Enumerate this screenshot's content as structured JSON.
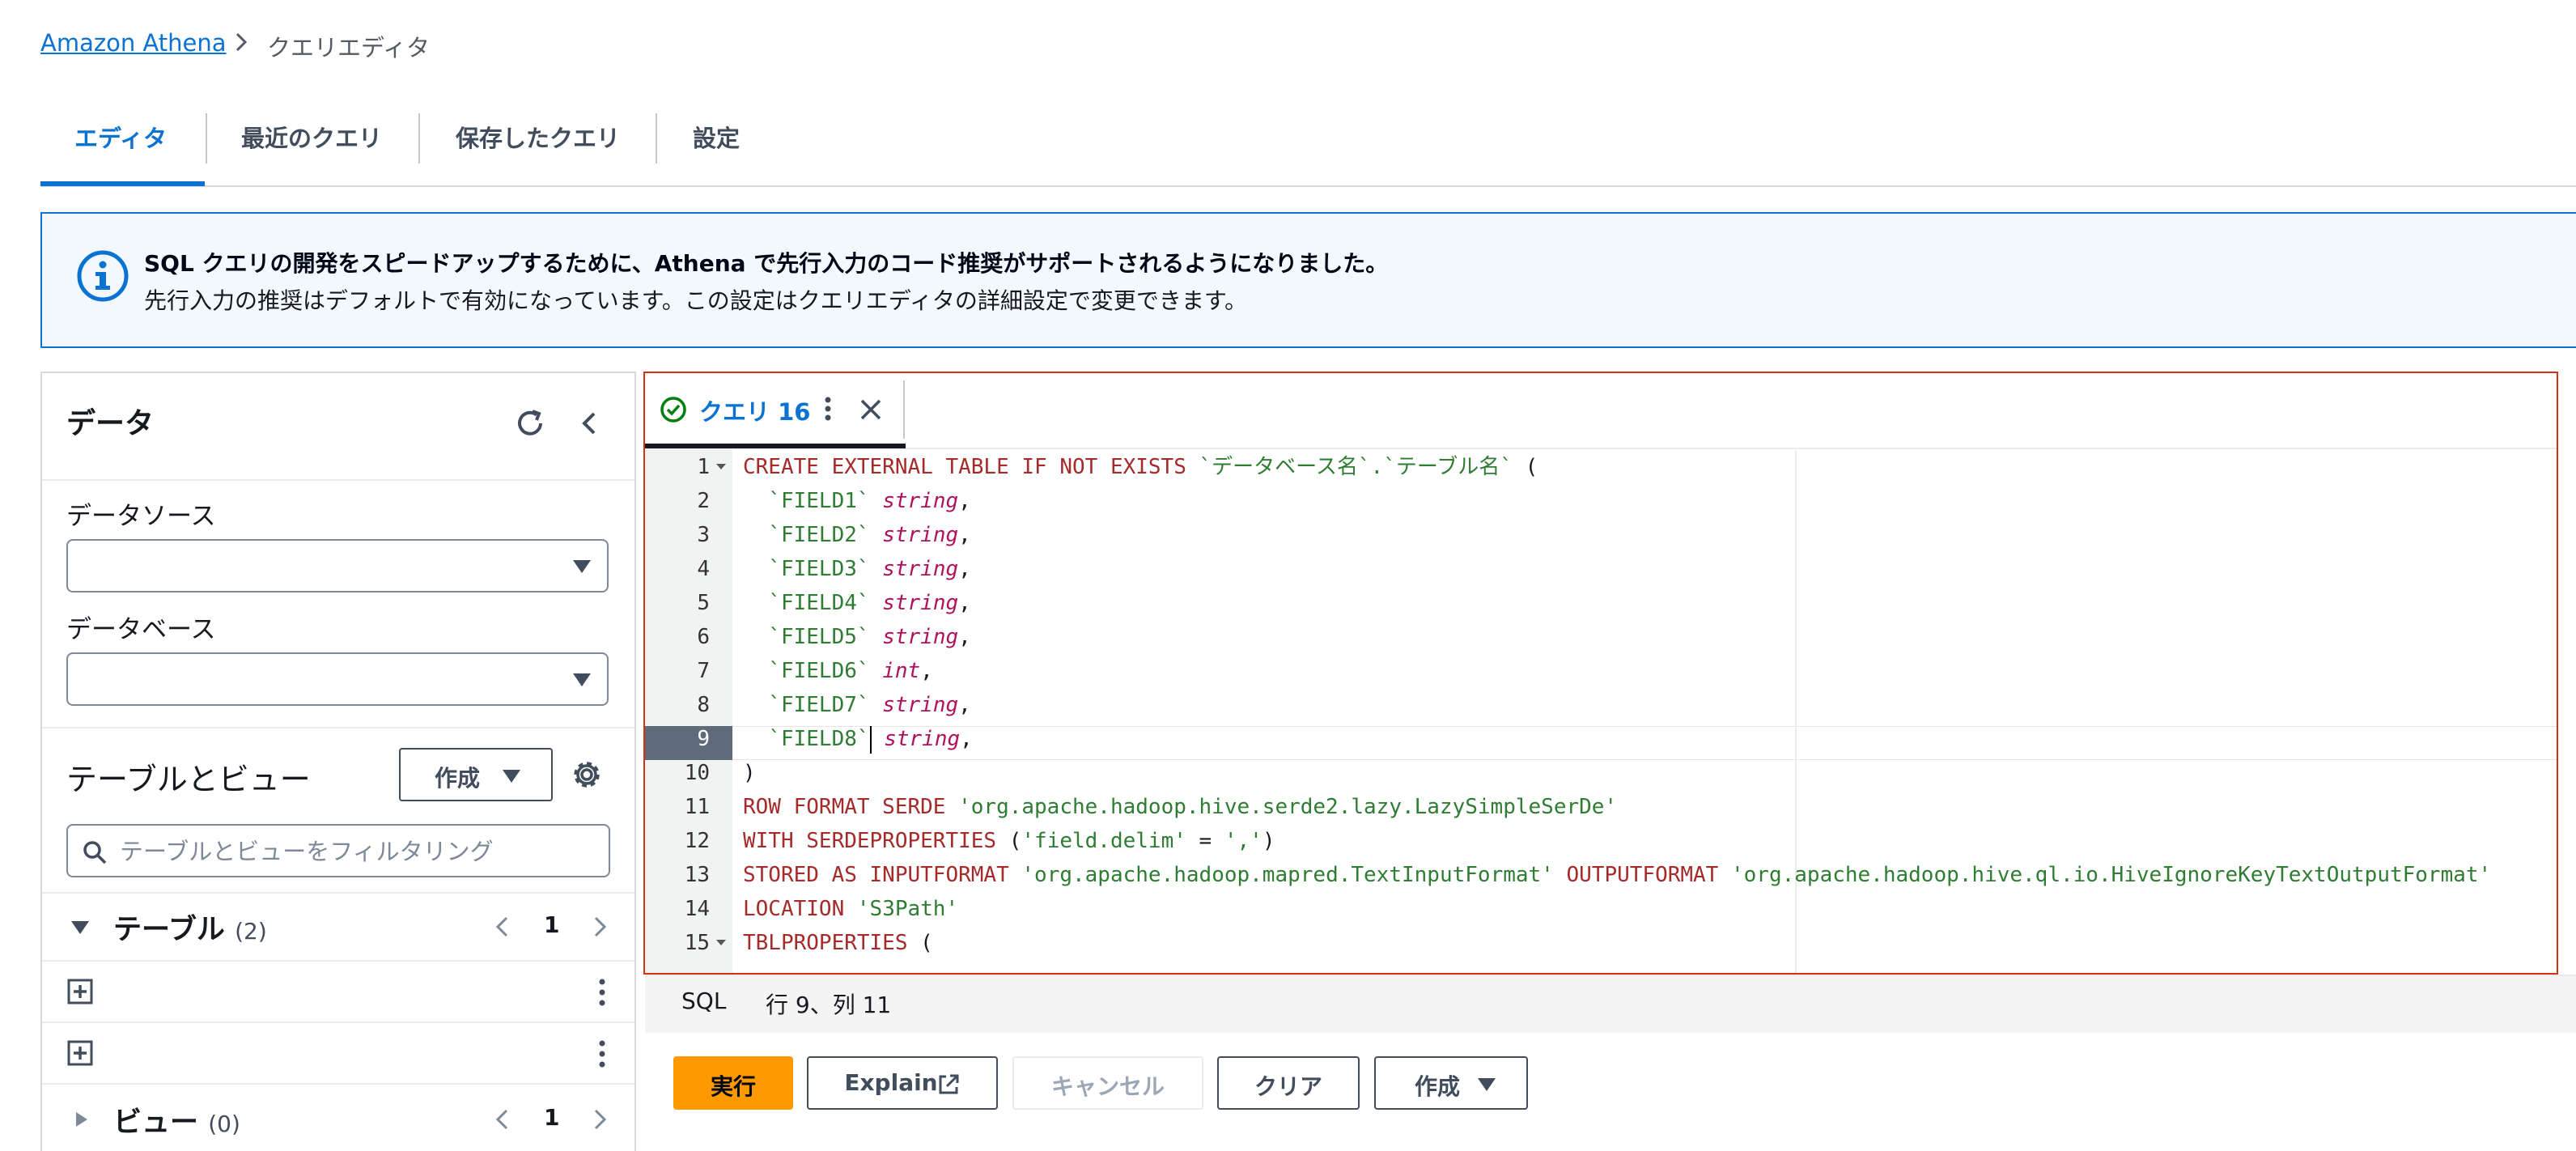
{
  "breadcrumb": {
    "root": "Amazon Athena",
    "current": "クエリエディタ"
  },
  "tabs": [
    {
      "label": "エディタ",
      "active": true
    },
    {
      "label": "最近のクエリ",
      "active": false
    },
    {
      "label": "保存したクエリ",
      "active": false
    },
    {
      "label": "設定",
      "active": false
    }
  ],
  "banner": {
    "icon": "info-icon",
    "title": "SQL クエリの開発をスピードアップするために、Athena で先行入力のコード推奨がサポートされるようになりました。",
    "body": "先行入力の推奨はデフォルトで有効になっています。この設定はクエリエディタの詳細設定で変更できます。"
  },
  "data_panel": {
    "title": "データ",
    "datasource_label": "データソース",
    "datasource_value": "",
    "database_label": "データベース",
    "database_value": "",
    "tables_views_title": "テーブルとビュー",
    "create_label": "作成",
    "filter_placeholder": "テーブルとビューをフィルタリング",
    "tables_section": {
      "label": "テーブル",
      "count": "(2)",
      "page": "1"
    },
    "views_section": {
      "label": "ビュー",
      "count": "(0)",
      "page": "1"
    }
  },
  "query_tab": {
    "label": "クエリ 16",
    "status_icon": "check-circle-icon"
  },
  "code_lines": [
    "1",
    "2",
    "3",
    "4",
    "5",
    "6",
    "7",
    "8",
    "9",
    "10",
    "11",
    "12",
    "13",
    "14",
    "15"
  ],
  "code": {
    "l1_kw": "CREATE EXTERNAL TABLE IF NOT EXISTS",
    "l1_id": "`データベース名`.`テーブル名`",
    "l1_end": " (",
    "fields": [
      {
        "name": "`FIELD1`",
        "type": "string",
        "end": ","
      },
      {
        "name": "`FIELD2`",
        "type": "string",
        "end": ","
      },
      {
        "name": "`FIELD3`",
        "type": "string",
        "end": ","
      },
      {
        "name": "`FIELD4`",
        "type": "string",
        "end": ","
      },
      {
        "name": "`FIELD5`",
        "type": "string",
        "end": ","
      },
      {
        "name": "`FIELD6`",
        "type": "int",
        "end": ","
      },
      {
        "name": "`FIELD7`",
        "type": "string",
        "end": ","
      },
      {
        "name": "`FIELD8`",
        "type": "string",
        "end": ","
      }
    ],
    "l10": ")",
    "l11_kw": "ROW FORMAT SERDE",
    "l11_str": "'org.apache.hadoop.hive.serde2.lazy.LazySimpleSerDe'",
    "l12_kw": "WITH SERDEPROPERTIES",
    "l12_p1": " (",
    "l12_str1": "'field.delim'",
    "l12_eq": " = ",
    "l12_str2": "','",
    "l12_p2": ")",
    "l13_kw1": "STORED AS INPUTFORMAT",
    "l13_str1": "'org.apache.hadoop.mapred.TextInputFormat'",
    "l13_kw2": "OUTPUTFORMAT",
    "l13_str2": "'org.apache.hadoop.hive.ql.io.HiveIgnoreKeyTextOutputFormat'",
    "l14_kw": "LOCATION",
    "l14_str": "'S3Path'",
    "l15_kw": "TBLPROPERTIES",
    "l15_end": " ("
  },
  "status_bar": {
    "language": "SQL",
    "cursor": "行 9、列 11"
  },
  "buttons": {
    "run": "実行",
    "explain": "Explain",
    "cancel": "キャンセル",
    "clear": "クリア",
    "create": "作成"
  },
  "colors": {
    "accent": "#0972d3",
    "run_button": "#ff9900",
    "highlight_border": "#d13212"
  }
}
